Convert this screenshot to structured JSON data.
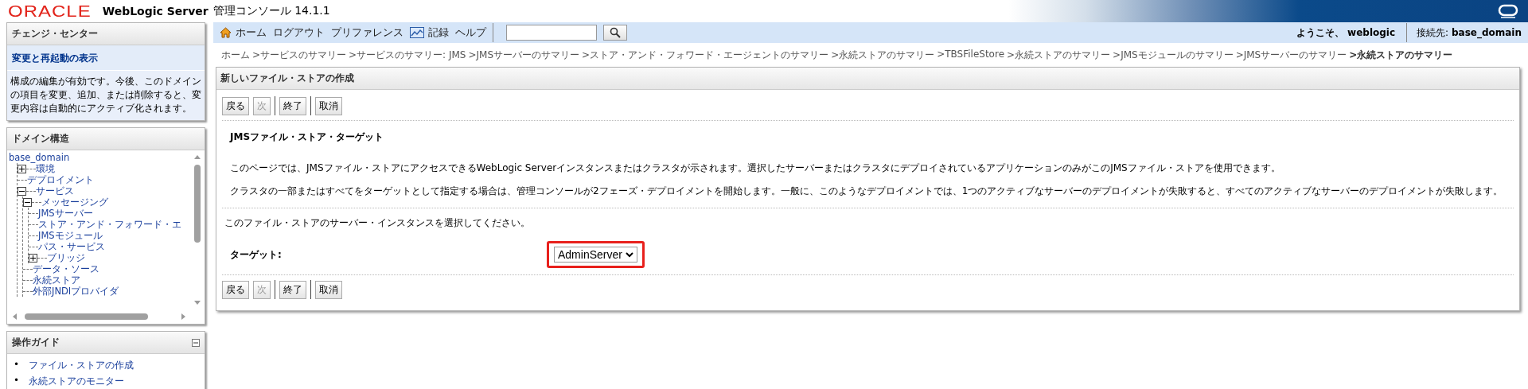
{
  "header": {
    "logo": "ORACLE",
    "product": "WebLogic Server",
    "subtitle": "管理コンソール 14.1.1"
  },
  "change_center": {
    "title": "チェンジ・センター",
    "link": "変更と再起動の表示",
    "message": "構成の編集が有効です。今後、このドメインの項目を変更、追加、または削除すると、変更内容は自動的にアクティブ化されます。"
  },
  "domain_structure": {
    "title": "ドメイン構造",
    "tree": {
      "label": "base_domain",
      "children": [
        {
          "label": "環境",
          "expanded": false
        },
        {
          "label": "デプロイメント"
        },
        {
          "label": "サービス",
          "expanded": true,
          "children": [
            {
              "label": "メッセージング",
              "expanded": true,
              "children": [
                {
                  "label": "JMSサーバー"
                },
                {
                  "label": "ストア・アンド・フォワード・エ"
                },
                {
                  "label": "JMSモジュール"
                },
                {
                  "label": "パス・サービス"
                },
                {
                  "label": "ブリッジ",
                  "expanded": false
                }
              ]
            },
            {
              "label": "データ・ソース"
            },
            {
              "label": "永続ストア"
            },
            {
              "label": "外部JNDIプロバイダ"
            }
          ]
        }
      ]
    }
  },
  "how_do_i": {
    "title": "操作ガイド",
    "links": [
      {
        "bullet": "•",
        "label": "ファイル・ストアの作成"
      },
      {
        "bullet": "•",
        "label": "永続ストアのモニター"
      }
    ]
  },
  "toolbar": {
    "links": [
      {
        "label": "ホーム",
        "kind": "home"
      },
      {
        "label": "ログアウト"
      },
      {
        "label": "プリファレンス"
      },
      {
        "label": "記録",
        "kind": "record"
      },
      {
        "label": "ヘルプ"
      }
    ]
  },
  "welcome": {
    "greeting": "ようこそ、",
    "user": "weblogic",
    "connection_label": "接続先:",
    "domain": "base_domain"
  },
  "breadcrumbs": [
    {
      "label": "ホーム",
      "current": false
    },
    {
      "label": ">サービスのサマリー",
      "current": false
    },
    {
      "label": ">サービスのサマリー: JMS",
      "current": false
    },
    {
      "label": ">JMSサーバーのサマリー",
      "current": false
    },
    {
      "label": ">ストア・アンド・フォワード・エージェントのサマリー",
      "current": false
    },
    {
      "label": ">永続ストアのサマリー",
      "current": false
    },
    {
      "label": ">TBSFileStore",
      "current": false
    },
    {
      "label": ">永続ストアのサマリー",
      "current": false
    },
    {
      "label": ">JMSモジュールのサマリー",
      "current": false
    },
    {
      "label": ">JMSサーバーのサマリー",
      "current": false
    },
    {
      "label": ">永続ストアのサマリー",
      "current": true
    }
  ],
  "panel": {
    "title": "新しいファイル・ストアの作成",
    "buttons_top": [
      {
        "label": "戻る",
        "disabled": false
      },
      {
        "label": "次",
        "disabled": true
      },
      {
        "label": "終了",
        "disabled": false
      },
      {
        "label": "取消",
        "disabled": false
      }
    ],
    "section_title": "JMSファイル・ストア・ターゲット",
    "paragraphs": [
      "このページでは、JMSファイル・ストアにアクセスできるWebLogic Serverインスタンスまたはクラスタが示されます。選択したサーバーまたはクラスタにデプロイされているアプリケーションのみがこのJMSファイル・ストアを使用できます。",
      "クラスタの一部またはすべてをターゲットとして指定する場合は、管理コンソールが2フェーズ・デプロイメントを開始します。一般に、このようなデプロイメントでは、1つのアクティブなサーバーのデプロイメントが失敗すると、すべてのアクティブなサーバーのデプロイメントが失敗します。"
    ],
    "instruction": "このファイル・ストアのサーバー・インスタンスを選択してください。",
    "target": {
      "label": "ターゲット:",
      "value": "AdminServer",
      "highlighted": true
    },
    "buttons_bottom": [
      {
        "label": "戻る",
        "disabled": false
      },
      {
        "label": "次",
        "disabled": true
      },
      {
        "label": "終了",
        "disabled": false
      },
      {
        "label": "取消",
        "disabled": false
      }
    ]
  }
}
